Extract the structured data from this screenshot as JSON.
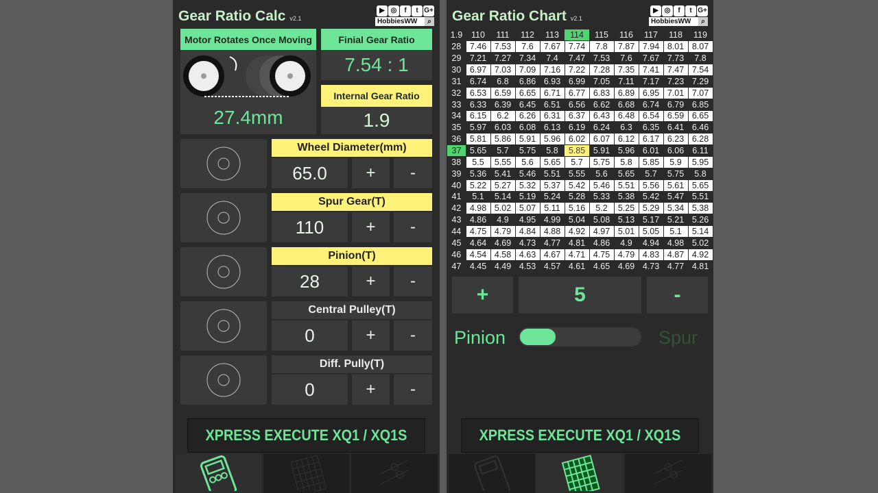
{
  "calc": {
    "title": "Gear Ratio Calc",
    "version": "v2.1",
    "brand": "HobbiesWW",
    "social_icons": [
      "youtube-icon",
      "instagram-icon",
      "facebook-icon",
      "twitter-icon",
      "google-plus-icon"
    ],
    "motor_label": "Motor Rotates Once Moving",
    "motor_value": "27.4mm",
    "final_label": "Finial Gear Ratio",
    "final_value": "7.54 : 1",
    "internal_label": "Internal Gear Ratio",
    "internal_value": "1.9",
    "params": [
      {
        "label": "Wheel Diameter(mm)",
        "value": "65.0",
        "highlight": true
      },
      {
        "label": "Spur Gear(T)",
        "value": "110",
        "highlight": true
      },
      {
        "label": "Pinion(T)",
        "value": "28",
        "highlight": true
      },
      {
        "label": "Central Pulley(T)",
        "value": "0",
        "highlight": false
      },
      {
        "label": "Diff. Pully(T)",
        "value": "0",
        "highlight": false
      }
    ],
    "plus": "+",
    "minus": "-",
    "banner": "XPRESS EXECUTE XQ1 / XQ1S"
  },
  "chart": {
    "title": "Gear Ratio Chart",
    "version": "v2.1",
    "brand": "HobbiesWW",
    "corner": "1.9",
    "spur": [
      "110",
      "111",
      "112",
      "113",
      "114",
      "115",
      "116",
      "117",
      "118",
      "119"
    ],
    "selected_spur": "114",
    "selected_pinion": "37",
    "rows": [
      [
        "28",
        "7.46",
        "7.53",
        "7.6",
        "7.67",
        "7.74",
        "7.8",
        "7.87",
        "7.94",
        "8.01",
        "8.07"
      ],
      [
        "29",
        "7.21",
        "7.27",
        "7.34",
        "7.4",
        "7.47",
        "7.53",
        "7.6",
        "7.67",
        "7.73",
        "7.8"
      ],
      [
        "30",
        "6.97",
        "7.03",
        "7.09",
        "7.16",
        "7.22",
        "7.28",
        "7.35",
        "7.41",
        "7.47",
        "7.54"
      ],
      [
        "31",
        "6.74",
        "6.8",
        "6.86",
        "6.93",
        "6.99",
        "7.05",
        "7.11",
        "7.17",
        "7.23",
        "7.29"
      ],
      [
        "32",
        "6.53",
        "6.59",
        "6.65",
        "6.71",
        "6.77",
        "6.83",
        "6.89",
        "6.95",
        "7.01",
        "7.07"
      ],
      [
        "33",
        "6.33",
        "6.39",
        "6.45",
        "6.51",
        "6.56",
        "6.62",
        "6.68",
        "6.74",
        "6.79",
        "6.85"
      ],
      [
        "34",
        "6.15",
        "6.2",
        "6.26",
        "6.31",
        "6.37",
        "6.43",
        "6.48",
        "6.54",
        "6.59",
        "6.65"
      ],
      [
        "35",
        "5.97",
        "6.03",
        "6.08",
        "6.13",
        "6.19",
        "6.24",
        "6.3",
        "6.35",
        "6.41",
        "6.46"
      ],
      [
        "36",
        "5.81",
        "5.86",
        "5.91",
        "5.96",
        "6.02",
        "6.07",
        "6.12",
        "6.17",
        "6.23",
        "6.28"
      ],
      [
        "37",
        "5.65",
        "5.7",
        "5.75",
        "5.8",
        "5.85",
        "5.91",
        "5.96",
        "6.01",
        "6.06",
        "6.11"
      ],
      [
        "38",
        "5.5",
        "5.55",
        "5.6",
        "5.65",
        "5.7",
        "5.75",
        "5.8",
        "5.85",
        "5.9",
        "5.95"
      ],
      [
        "39",
        "5.36",
        "5.41",
        "5.46",
        "5.51",
        "5.55",
        "5.6",
        "5.65",
        "5.7",
        "5.75",
        "5.8"
      ],
      [
        "40",
        "5.22",
        "5.27",
        "5.32",
        "5.37",
        "5.42",
        "5.46",
        "5.51",
        "5.56",
        "5.61",
        "5.65"
      ],
      [
        "41",
        "5.1",
        "5.14",
        "5.19",
        "5.24",
        "5.28",
        "5.33",
        "5.38",
        "5.42",
        "5.47",
        "5.51"
      ],
      [
        "42",
        "4.98",
        "5.02",
        "5.07",
        "5.11",
        "5.16",
        "5.2",
        "5.25",
        "5.29",
        "5.34",
        "5.38"
      ],
      [
        "43",
        "4.86",
        "4.9",
        "4.95",
        "4.99",
        "5.04",
        "5.08",
        "5.13",
        "5.17",
        "5.21",
        "5.26"
      ],
      [
        "44",
        "4.75",
        "4.79",
        "4.84",
        "4.88",
        "4.92",
        "4.97",
        "5.01",
        "5.05",
        "5.1",
        "5.14"
      ],
      [
        "45",
        "4.64",
        "4.69",
        "4.73",
        "4.77",
        "4.81",
        "4.86",
        "4.9",
        "4.94",
        "4.98",
        "5.02"
      ],
      [
        "46",
        "4.54",
        "4.58",
        "4.63",
        "4.67",
        "4.71",
        "4.75",
        "4.79",
        "4.83",
        "4.87",
        "4.92"
      ],
      [
        "47",
        "4.45",
        "4.49",
        "4.53",
        "4.57",
        "4.61",
        "4.65",
        "4.69",
        "4.73",
        "4.77",
        "4.81"
      ]
    ],
    "plus": "+",
    "step": "5",
    "minus": "-",
    "toggle_left": "Pinion",
    "toggle_right": "Spur",
    "toggle_state": "pinion",
    "banner": "XPRESS EXECUTE XQ1 / XQ1S"
  },
  "nav": {
    "tabs": [
      "calculator",
      "chart",
      "settings"
    ],
    "left_active": "calculator",
    "right_active": "chart"
  },
  "colors": {
    "accent": "#6ee69a",
    "highlight": "#fff27a",
    "panel": "#2a2a2a"
  }
}
